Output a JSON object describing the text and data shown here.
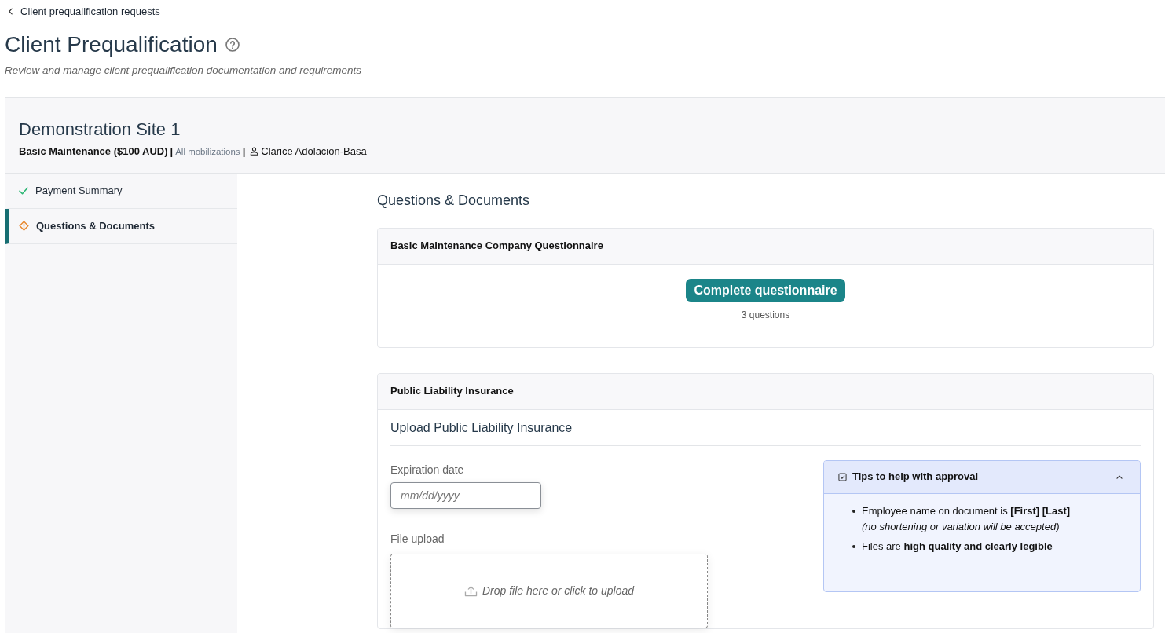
{
  "back_link": {
    "label": "Client prequalification requests"
  },
  "page": {
    "title": "Client Prequalification",
    "subtitle": "Review and manage client prequalification documentation and requirements"
  },
  "site": {
    "name": "Demonstration Site 1",
    "details": [
      {
        "kind": "package",
        "text": "Basic Maintenance ($100 AUD)"
      },
      {
        "kind": "separator",
        "text": "|"
      },
      {
        "kind": "scope",
        "text": "All mobilizations"
      },
      {
        "kind": "separator",
        "text": "|"
      },
      {
        "kind": "person",
        "text": "Clarice Adolacion-Basa"
      }
    ]
  },
  "sidebar": {
    "items": [
      {
        "label": "Payment Summary",
        "kind": "complete",
        "selected": false
      },
      {
        "label": "Questions & Documents",
        "kind": "attention",
        "selected": true
      }
    ]
  },
  "main": {
    "title": "Questions & Documents",
    "cards": [
      {
        "kind": "questionnaire",
        "title": "Basic Maintenance Company Questionnaire",
        "button": "Complete questionnaire",
        "note": "3 questions"
      },
      {
        "kind": "upload",
        "title": "Public Liability Insurance",
        "heading": "Upload Public Liability Insurance",
        "fields": [
          {
            "kind": "date",
            "label": "Expiration date",
            "placeholder": "mm/dd/yyyy"
          },
          {
            "kind": "file",
            "label": "File upload",
            "prompt": "Drop file here or click to upload"
          }
        ],
        "tips": {
          "title": "Tips to help with approval",
          "expanded": true,
          "items": [
            {
              "text": "Employee name on document is **[First] [Last]**",
              "note": "(no shortening or variation will be accepted)"
            },
            {
              "text": "Files are **high quality and clearly legible**"
            }
          ]
        }
      }
    ]
  }
}
